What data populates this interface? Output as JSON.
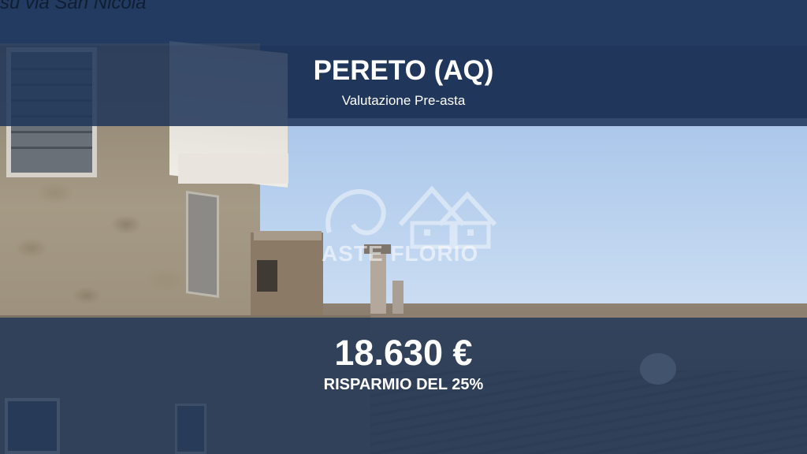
{
  "top_caption": "su via San Nicola",
  "header": {
    "city": "PERETO (AQ)",
    "subtitle": "Valutazione Pre-asta"
  },
  "footer": {
    "price": "18.630 €",
    "saving": "RISPARMIO DEL 25%"
  },
  "watermark": {
    "text": "ASTE FLORIO",
    "icon": "lion-house-logo-icon"
  },
  "colors": {
    "band": "#1e3458",
    "text": "#ffffff"
  }
}
